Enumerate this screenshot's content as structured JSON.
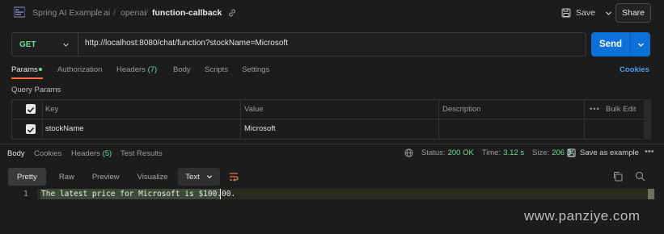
{
  "breadcrumb": {
    "items": [
      "Spring AI Example",
      "ai",
      "openai"
    ],
    "current": "function-callback",
    "separator": "/"
  },
  "header": {
    "save_label": "Save",
    "share_label": "Share"
  },
  "request": {
    "method": "GET",
    "url": "http://localhost:8080/chat/function?stockName=Microsoft",
    "send_label": "Send"
  },
  "request_tabs": {
    "params": "Params",
    "authorization": "Authorization",
    "headers": "Headers",
    "headers_count": "(7)",
    "body": "Body",
    "scripts": "Scripts",
    "settings": "Settings",
    "cookies": "Cookies"
  },
  "query_params": {
    "title": "Query Params",
    "columns": {
      "key": "Key",
      "value": "Value",
      "description": "Description",
      "bulk_edit": "Bulk Edit"
    },
    "rows": [
      {
        "key": "stockName",
        "value": "Microsoft",
        "description": "",
        "checked": true
      }
    ]
  },
  "response_tabs": {
    "body": "Body",
    "cookies": "Cookies",
    "headers": "Headers",
    "headers_count": "(5)",
    "test_results": "Test Results"
  },
  "response_meta": {
    "status_label": "Status:",
    "status_value": "200 OK",
    "time_label": "Time:",
    "time_value": "3.12 s",
    "size_label": "Size:",
    "size_value": "206 B",
    "save_example": "Save as example"
  },
  "format_bar": {
    "pretty": "Pretty",
    "raw": "Raw",
    "preview": "Preview",
    "visualize": "Visualize",
    "language": "Text"
  },
  "response_body": {
    "line_number": "1",
    "text": "The latest price for Microsoft is $100.00."
  },
  "watermark": "www.panziye.com",
  "colors": {
    "background": "#1c1c1c",
    "method_get": "#6bdd9a",
    "send_button": "#0b70d8",
    "active_tab_accent": "#ff6c37",
    "link": "#4a9cf0",
    "status_ok": "#6bdd9a"
  }
}
